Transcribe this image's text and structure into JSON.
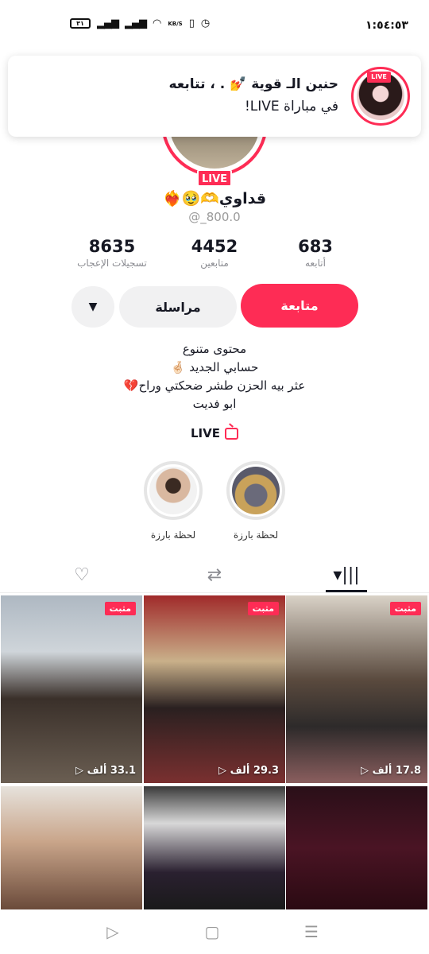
{
  "status_bar": {
    "time": "١:٥٤:٥٣",
    "battery": "٣١",
    "network_speed": "KB/S"
  },
  "notification": {
    "title": "حنين الـ قوية 💅 . ، تتابعه",
    "subtitle": "في مباراة LIVE!",
    "avatar_badge": "LIVE"
  },
  "profile": {
    "live_badge": "LIVE",
    "username": "قداوي🫶🥹❤️‍🔥",
    "handle": "@_800.0",
    "stats": [
      {
        "value": "683",
        "label": "أتابعه"
      },
      {
        "value": "4452",
        "label": "متابعين"
      },
      {
        "value": "8635",
        "label": "تسجيلات الإعجاب"
      }
    ],
    "buttons": {
      "follow": "متابعة",
      "message": "مراسلة",
      "more": "▼"
    },
    "bio": [
      "محتوى متنوع",
      "حسابي الجديد 🤞🏻",
      "عثر بيه الحزن طشر ضحكتي وراح💔",
      "ابو فديت"
    ]
  },
  "live_link": {
    "label": "LIVE"
  },
  "highlights": [
    {
      "label": "لحظة بارزة"
    },
    {
      "label": "لحظة بارزة"
    }
  ],
  "tabs": [
    {
      "name": "videos",
      "icon": "grid-icon"
    },
    {
      "name": "reposts",
      "icon": "repost-icon"
    },
    {
      "name": "liked",
      "icon": "heart-icon"
    }
  ],
  "videos": [
    {
      "pinned": "مثبت",
      "views": "17.8 ألف"
    },
    {
      "pinned": "مثبت",
      "views": "29.3 ألف"
    },
    {
      "pinned": "مثبت",
      "views": "33.1 ألف"
    },
    {
      "pinned": "",
      "views": ""
    },
    {
      "pinned": "",
      "views": ""
    },
    {
      "pinned": "",
      "views": ""
    }
  ],
  "navigation": [
    {
      "icon": "menu-icon"
    },
    {
      "icon": "home-square-icon"
    },
    {
      "icon": "back-triangle-icon"
    }
  ]
}
